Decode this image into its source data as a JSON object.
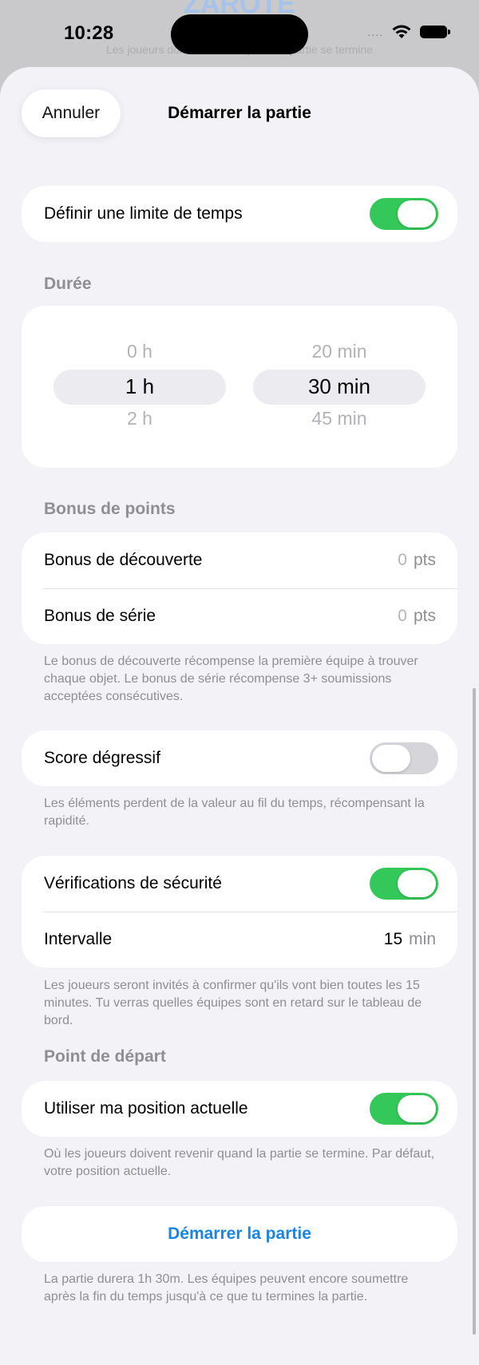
{
  "background": {
    "title": "ZAROTE",
    "subtitle": "Les joueurs doivent revenir quand la partie se termine"
  },
  "status_bar": {
    "time": "10:28",
    "dots": "....",
    "wifi_icon": "wifi-icon",
    "battery_icon": "battery-icon"
  },
  "nav": {
    "cancel_label": "Annuler",
    "title": "Démarrer la partie"
  },
  "time_limit": {
    "label": "Définir une limite de temps",
    "enabled": true
  },
  "duration": {
    "header": "Durée",
    "hours": {
      "above": "0 h",
      "selected": "1 h",
      "below": "2 h"
    },
    "minutes": {
      "above": "20 min",
      "selected": "30 min",
      "below": "45 min"
    }
  },
  "bonus": {
    "header": "Bonus de points",
    "discovery": {
      "label": "Bonus de découverte",
      "value": "0",
      "unit": "pts"
    },
    "streak": {
      "label": "Bonus de série",
      "value": "0",
      "unit": "pts"
    },
    "footnote": "Le bonus de découverte récompense la première équipe à trouver chaque objet. Le bonus de série récompense 3+ soumissions acceptées consécutives."
  },
  "decay": {
    "label": "Score dégressif",
    "enabled": false,
    "footnote": "Les éléments perdent de la valeur au fil du temps, récompensant la rapidité."
  },
  "safety": {
    "label": "Vérifications de sécurité",
    "enabled": true,
    "interval_label": "Intervalle",
    "interval_value": "15",
    "interval_unit": "min",
    "footnote": "Les joueurs seront invités à confirmer qu'ils vont bien toutes les 15 minutes. Tu verras quelles équipes sont en retard sur le tableau de bord."
  },
  "start_point": {
    "header": "Point de départ",
    "label": "Utiliser ma position actuelle",
    "enabled": true,
    "footnote": "Où les joueurs doivent revenir quand la partie se termine. Par défaut, votre position actuelle."
  },
  "start": {
    "button_label": "Démarrer la partie",
    "footnote": "La partie durera 1h 30m. Les équipes peuvent encore soumettre après la fin du temps jusqu'à ce que tu termines la partie."
  },
  "colors": {
    "accent": "#1a85e6",
    "toggle_on": "#34c759",
    "toggle_off": "#d6d6da",
    "sheet_bg": "#f2f2f7"
  }
}
